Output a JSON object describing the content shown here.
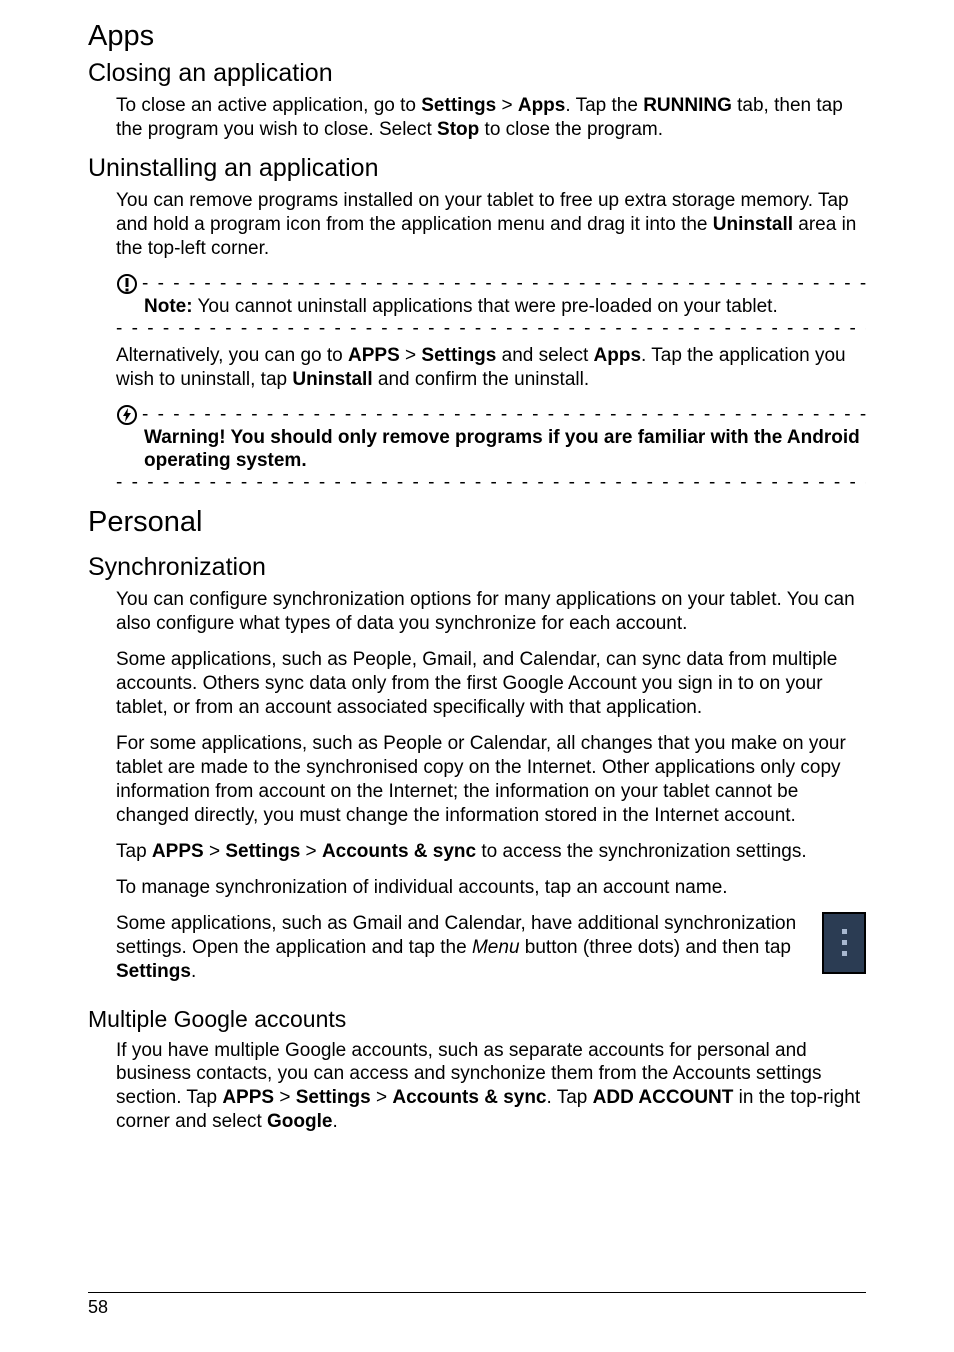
{
  "headings": {
    "apps": "Apps",
    "closing": "Closing an application",
    "uninstalling": "Uninstalling an application",
    "personal": "Personal",
    "sync": "Synchronization",
    "multiple": "Multiple Google accounts"
  },
  "paragraphs": {
    "closing_p": "To close an active application, go to <b>Settings</b> > <b>Apps</b>. Tap the <b>RUNNING</b> tab, then tap the program you wish to close. Select <b>Stop</b> to close the program.",
    "uninstall_p1": "You can remove programs installed on your tablet to free up extra storage memory. Tap and hold a program icon from the application menu and drag it into the <b>Uninstall</b> area in the top-left corner.",
    "note_text": "<b>Note:</b> You cannot uninstall applications that were pre-loaded on your tablet.",
    "uninstall_p2": "Alternatively, you can go to <b>APPS</b> > <b>Settings</b> and select <b>Apps</b>. Tap the application you wish to uninstall, tap <b>Uninstall</b> and confirm the uninstall.",
    "warning_text": "<b>Warning! You should only remove programs if you are familiar with the Android operating system.</b>",
    "sync_p1": "You can configure synchronization options for many applications on your tablet. You can also configure what types of data you synchronize for each account.",
    "sync_p2": "Some applications, such as People, Gmail, and Calendar, can sync data from multiple accounts. Others sync data only from the first Google Account you sign in to on your tablet, or from an account associated specifically with that application.",
    "sync_p3": "For some applications, such as People or Calendar, all changes that you make on your tablet are made to the synchronised copy on the Internet. Other applications only copy information from account on the Internet; the information on your tablet cannot be changed directly, you must change the information stored in the Internet account.",
    "sync_p4": "Tap <b>APPS</b> > <b>Settings</b> > <b>Accounts &amp; sync</b> to access the synchronization settings.",
    "sync_p5": "To manage synchronization of individual accounts, tap an account name.",
    "sync_p6": "Some applications, such as Gmail and Calendar, have additional synchronization settings. Open the application and tap the <i>Menu</i> button (three dots) and then tap <b>Settings</b>.",
    "multiple_p": "If you have multiple Google accounts, such as separate accounts for personal and business contacts, you can access and synchonize them from the Accounts settings section. Tap <b>APPS</b> > <b>Settings</b> > <b>Accounts &amp; sync</b>. Tap <b>ADD ACCOUNT</b> in the top-right corner and select <b>Google</b>."
  },
  "dash": "- - - - - - - - - - - - - - - - - - - - - - - - - - - - - - - - - - - - - - - - - - - - - - - - - - - - - - - - - - - - - - - - - - - - - - - - - - - - - - - - - - - - - - - - - - -",
  "page_number": "58"
}
